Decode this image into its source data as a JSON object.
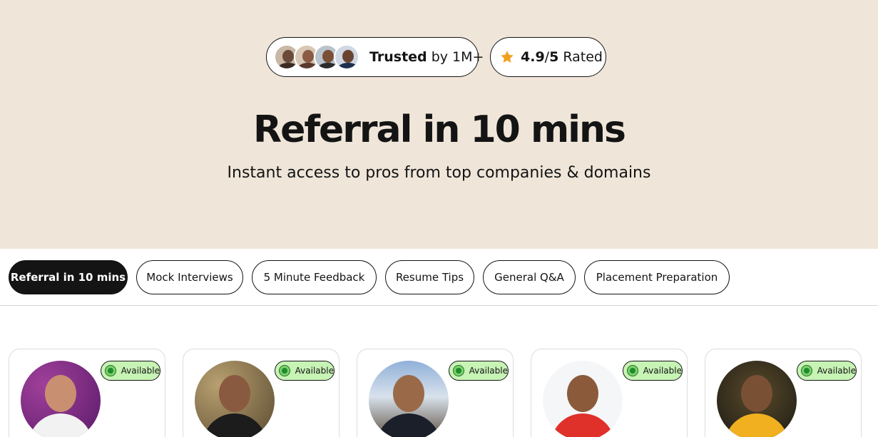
{
  "hero": {
    "trusted": {
      "bold": "Trusted",
      "rest": " by 1M+"
    },
    "rating": {
      "score": "4.9",
      "sep": "/",
      "max": "5",
      "label": " Rated"
    },
    "title": "Referral in 10 mins",
    "subtitle": "Instant access to pros from top companies & domains"
  },
  "tabs": [
    {
      "label": "Referral in 10 mins",
      "active": true
    },
    {
      "label": "Mock Interviews",
      "active": false
    },
    {
      "label": "5 Minute Feedback",
      "active": false
    },
    {
      "label": "Resume Tips",
      "active": false
    },
    {
      "label": "General Q&A",
      "active": false
    },
    {
      "label": "Placement Preparation",
      "active": false
    }
  ],
  "mentors": [
    {
      "status": "Available"
    },
    {
      "status": "Available"
    },
    {
      "status": "Available"
    },
    {
      "status": "Available"
    },
    {
      "status": "Available"
    }
  ],
  "colors": {
    "hero_bg": "#efe6d9",
    "available_badge": "#c7f3b5",
    "star": "#f0a020",
    "active_tab": "#141414"
  },
  "icons": {
    "rating": "star-icon",
    "status": "status-dot-icon"
  }
}
